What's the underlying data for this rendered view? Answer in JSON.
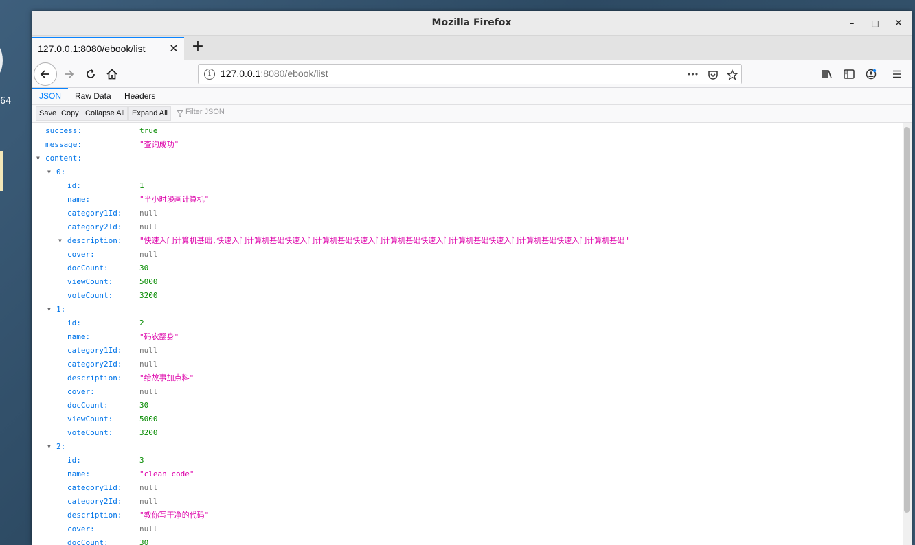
{
  "desktop": {
    "side_text": "64"
  },
  "window": {
    "title": "Mozilla Firefox",
    "minimize_glyph": "–",
    "maximize_glyph": "□",
    "close_glyph": "✕"
  },
  "tab": {
    "label": "127.0.0.1:8080/ebook/list",
    "close_glyph": "✕",
    "newtab_glyph": "+"
  },
  "urlbar": {
    "host": "127.0.0.1",
    "rest": ":8080/ebook/list",
    "more_glyph": "•••"
  },
  "viewer_tabs": [
    {
      "label": "JSON",
      "active": true
    },
    {
      "label": "Raw Data",
      "active": false
    },
    {
      "label": "Headers",
      "active": false
    }
  ],
  "toolbar": {
    "save": "Save",
    "copy": "Copy",
    "collapse_all": "Collapse All",
    "expand_all": "Expand All",
    "filter_placeholder": "Filter JSON"
  },
  "rows": [
    {
      "indent": 0,
      "twisty": false,
      "key": "success:",
      "value": "true",
      "type": "bool"
    },
    {
      "indent": 0,
      "twisty": false,
      "key": "message:",
      "value": "\"查询成功\"",
      "type": "str"
    },
    {
      "indent": 0,
      "twisty": true,
      "key": "content:",
      "value": "",
      "type": "none"
    },
    {
      "indent": 1,
      "twisty": true,
      "key": "0:",
      "value": "",
      "type": "none"
    },
    {
      "indent": 2,
      "twisty": false,
      "key": "id:",
      "value": "1",
      "type": "num"
    },
    {
      "indent": 2,
      "twisty": false,
      "key": "name:",
      "value": "\"半小时漫画计算机\"",
      "type": "str"
    },
    {
      "indent": 2,
      "twisty": false,
      "key": "category1Id:",
      "value": "null",
      "type": "null"
    },
    {
      "indent": 2,
      "twisty": false,
      "key": "category2Id:",
      "value": "null",
      "type": "null"
    },
    {
      "indent": 2,
      "twisty": true,
      "key": "description:",
      "value": "\"快速入门计算机基础,快速入门计算机基础快速入门计算机基础快速入门计算机基础快速入门计算机基础快速入门计算机基础快速入门计算机基础\"",
      "type": "str"
    },
    {
      "indent": 2,
      "twisty": false,
      "key": "cover:",
      "value": "null",
      "type": "null"
    },
    {
      "indent": 2,
      "twisty": false,
      "key": "docCount:",
      "value": "30",
      "type": "num"
    },
    {
      "indent": 2,
      "twisty": false,
      "key": "viewCount:",
      "value": "5000",
      "type": "num"
    },
    {
      "indent": 2,
      "twisty": false,
      "key": "voteCount:",
      "value": "3200",
      "type": "num"
    },
    {
      "indent": 1,
      "twisty": true,
      "key": "1:",
      "value": "",
      "type": "none"
    },
    {
      "indent": 2,
      "twisty": false,
      "key": "id:",
      "value": "2",
      "type": "num"
    },
    {
      "indent": 2,
      "twisty": false,
      "key": "name:",
      "value": "\"码农翻身\"",
      "type": "str"
    },
    {
      "indent": 2,
      "twisty": false,
      "key": "category1Id:",
      "value": "null",
      "type": "null"
    },
    {
      "indent": 2,
      "twisty": false,
      "key": "category2Id:",
      "value": "null",
      "type": "null"
    },
    {
      "indent": 2,
      "twisty": false,
      "key": "description:",
      "value": "\"给故事加点料\"",
      "type": "str"
    },
    {
      "indent": 2,
      "twisty": false,
      "key": "cover:",
      "value": "null",
      "type": "null"
    },
    {
      "indent": 2,
      "twisty": false,
      "key": "docCount:",
      "value": "30",
      "type": "num"
    },
    {
      "indent": 2,
      "twisty": false,
      "key": "viewCount:",
      "value": "5000",
      "type": "num"
    },
    {
      "indent": 2,
      "twisty": false,
      "key": "voteCount:",
      "value": "3200",
      "type": "num"
    },
    {
      "indent": 1,
      "twisty": true,
      "key": "2:",
      "value": "",
      "type": "none"
    },
    {
      "indent": 2,
      "twisty": false,
      "key": "id:",
      "value": "3",
      "type": "num"
    },
    {
      "indent": 2,
      "twisty": false,
      "key": "name:",
      "value": "\"clean code\"",
      "type": "str"
    },
    {
      "indent": 2,
      "twisty": false,
      "key": "category1Id:",
      "value": "null",
      "type": "null"
    },
    {
      "indent": 2,
      "twisty": false,
      "key": "category2Id:",
      "value": "null",
      "type": "null"
    },
    {
      "indent": 2,
      "twisty": false,
      "key": "description:",
      "value": "\"教你写干净的代码\"",
      "type": "str"
    },
    {
      "indent": 2,
      "twisty": false,
      "key": "cover:",
      "value": "null",
      "type": "null"
    },
    {
      "indent": 2,
      "twisty": false,
      "key": "docCount:",
      "value": "30",
      "type": "num"
    }
  ]
}
